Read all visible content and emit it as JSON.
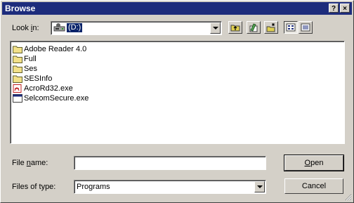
{
  "window": {
    "title": "Browse",
    "help_label": "?",
    "close_label": "×"
  },
  "lookin": {
    "label_pre": "Look ",
    "label_ul": "i",
    "label_post": "n:",
    "value": "(D:)"
  },
  "toolbar": {
    "buttons": [
      "up-one-level",
      "desktop",
      "create-new-folder",
      "list-view",
      "details-view"
    ]
  },
  "files": [
    {
      "name": "Adobe Reader 4.0",
      "icon": "folder-icon"
    },
    {
      "name": "Full",
      "icon": "folder-icon"
    },
    {
      "name": "Ses",
      "icon": "folder-icon"
    },
    {
      "name": "SESInfo",
      "icon": "folder-icon"
    },
    {
      "name": "AcroRd32.exe",
      "icon": "acrobat-exe-icon"
    },
    {
      "name": "SelcomSecure.exe",
      "icon": "application-exe-icon"
    }
  ],
  "filename": {
    "label_pre": "File ",
    "label_ul": "n",
    "label_post": "ame:",
    "value": ""
  },
  "filetype": {
    "label": "Files of type:",
    "value": "Programs"
  },
  "buttons": {
    "open_ul": "O",
    "open_rest": "pen",
    "cancel": "Cancel"
  },
  "colors": {
    "titlebar": "#1d2c7c",
    "face": "#d4d0c8",
    "selection": "#0a246a"
  }
}
